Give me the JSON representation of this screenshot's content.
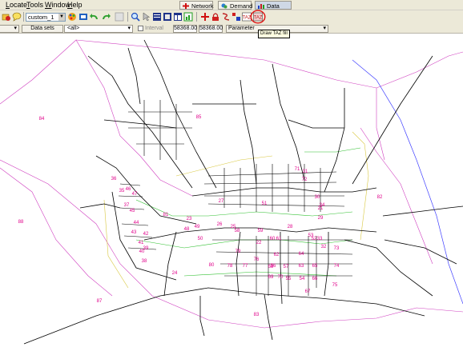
{
  "menu": {
    "items": [
      {
        "label": "Locate",
        "underline": "L",
        "rest": "ocate"
      },
      {
        "label": "Tools",
        "underline": "T",
        "rest": "ools"
      },
      {
        "label": "Window",
        "underline": "W",
        "rest": "indow"
      },
      {
        "label": "Help",
        "underline": "H",
        "rest": "elp"
      }
    ]
  },
  "tabs": [
    {
      "label": "Network",
      "icon": "network-icon",
      "active": false
    },
    {
      "label": "Demand",
      "icon": "demand-icon",
      "active": false
    },
    {
      "label": "Data",
      "icon": "data-icon",
      "active": true
    }
  ],
  "toolbar": {
    "graphic_parameters": "custom_1",
    "tooltip": "Draw TAZ fill"
  },
  "options": {
    "data_sets": "Data sets",
    "filter": "<all>",
    "interval_label": "Interval",
    "value_from": "58368.00",
    "value_to": "58368.00",
    "parameter": "Parameter"
  },
  "zones": [
    {
      "label": "84"
    },
    {
      "label": "85"
    },
    {
      "label": "88"
    },
    {
      "label": "87"
    },
    {
      "label": "82"
    },
    {
      "label": "83"
    },
    {
      "label": "81"
    },
    {
      "label": "80"
    },
    {
      "label": "79"
    },
    {
      "label": "78"
    },
    {
      "label": "77"
    },
    {
      "label": "76"
    },
    {
      "label": "75"
    },
    {
      "label": "74"
    },
    {
      "label": "73"
    },
    {
      "label": "72"
    },
    {
      "label": "71"
    },
    {
      "label": "70"
    },
    {
      "label": "69"
    },
    {
      "label": "68"
    },
    {
      "label": "67"
    },
    {
      "label": "66"
    },
    {
      "label": "65"
    },
    {
      "label": "64"
    },
    {
      "label": "63"
    },
    {
      "label": "62"
    },
    {
      "label": "61"
    },
    {
      "label": "60"
    },
    {
      "label": "59"
    },
    {
      "label": "58"
    },
    {
      "label": "57"
    },
    {
      "label": "56"
    },
    {
      "label": "55"
    },
    {
      "label": "54"
    },
    {
      "label": "53"
    },
    {
      "label": "52"
    },
    {
      "label": "51"
    },
    {
      "label": "50"
    },
    {
      "label": "49"
    },
    {
      "label": "48"
    },
    {
      "label": "47"
    },
    {
      "label": "46"
    },
    {
      "label": "45"
    },
    {
      "label": "44"
    },
    {
      "label": "43"
    },
    {
      "label": "42"
    },
    {
      "label": "41"
    },
    {
      "label": "40"
    },
    {
      "label": "39"
    },
    {
      "label": "38"
    },
    {
      "label": "37"
    },
    {
      "label": "36"
    },
    {
      "label": "35"
    },
    {
      "label": "34"
    },
    {
      "label": "33"
    },
    {
      "label": "32"
    },
    {
      "label": "31"
    },
    {
      "label": "30"
    },
    {
      "label": "29"
    },
    {
      "label": "28"
    },
    {
      "label": "27"
    },
    {
      "label": "26"
    },
    {
      "label": "25"
    },
    {
      "label": "24"
    },
    {
      "label": "23"
    },
    {
      "label": "22"
    },
    {
      "label": "21"
    }
  ],
  "colors": {
    "zone_label": "#e0008a",
    "zone_border": "#d040c0",
    "road": "#000000",
    "green_line": "#30c030",
    "yellow_line": "#d8c840",
    "blue_line": "#4040ff"
  }
}
